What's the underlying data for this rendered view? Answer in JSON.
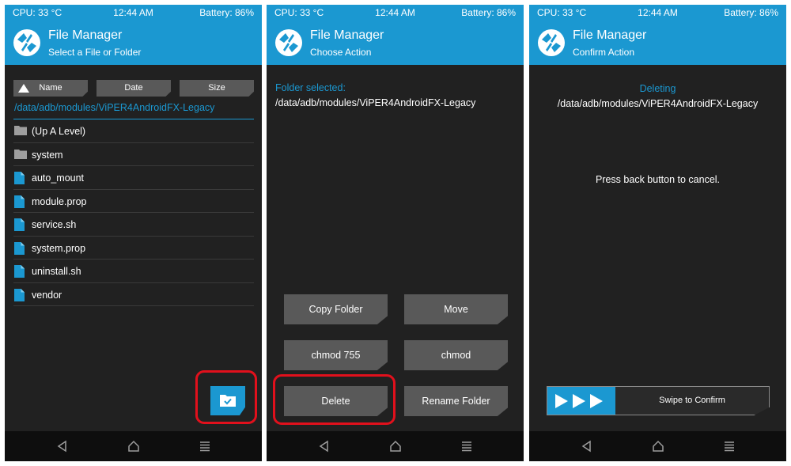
{
  "status": {
    "cpu": "CPU: 33 °C",
    "time": "12:44 AM",
    "battery": "Battery: 86%"
  },
  "colors": {
    "accent": "#1b98d1",
    "background": "#212121",
    "button": "#595959",
    "highlight": "#e1101c"
  },
  "panel1": {
    "title": "File Manager",
    "subtitle": "Select a File or Folder",
    "sort": {
      "name": "Name",
      "date": "Date",
      "size": "Size"
    },
    "path": "/data/adb/modules/ViPER4AndroidFX-Legacy",
    "items": [
      {
        "name": "(Up A Level)",
        "type": "folder"
      },
      {
        "name": "system",
        "type": "folder"
      },
      {
        "name": "auto_mount",
        "type": "file"
      },
      {
        "name": "module.prop",
        "type": "file"
      },
      {
        "name": "service.sh",
        "type": "file"
      },
      {
        "name": "system.prop",
        "type": "file"
      },
      {
        "name": "uninstall.sh",
        "type": "file"
      },
      {
        "name": "vendor",
        "type": "file"
      }
    ],
    "fab_icon": "folder-check-icon"
  },
  "panel2": {
    "title": "File Manager",
    "subtitle": "Choose Action",
    "label": "Folder selected:",
    "path": "/data/adb/modules/ViPER4AndroidFX-Legacy",
    "buttons": {
      "copy": "Copy Folder",
      "move": "Move",
      "chmod755": "chmod 755",
      "chmod": "chmod",
      "delete": "Delete",
      "rename": "Rename Folder"
    }
  },
  "panel3": {
    "title": "File Manager",
    "subtitle": "Confirm Action",
    "label": "Deleting",
    "path": "/data/adb/modules/ViPER4AndroidFX-Legacy",
    "message": "Press back button to cancel.",
    "swipe": "Swipe to Confirm"
  }
}
